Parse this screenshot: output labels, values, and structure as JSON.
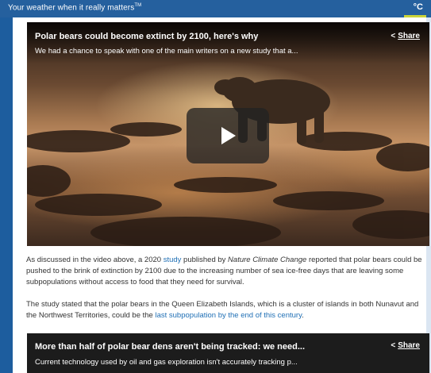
{
  "header": {
    "tagline": "Your weather when it really matters",
    "trademark": "TM",
    "unit": "°C"
  },
  "video": {
    "title": "Polar bears could become extinct by 2100, here's why",
    "description": "We had a chance to speak with one of the main writers on a new study that a...",
    "share_label": "Share"
  },
  "article": {
    "p1": {
      "t1": "As discussed in the video above, a 2020 ",
      "link": "study",
      "t2": " published by ",
      "journal": "Nature Climate Change",
      "t3": " reported that polar bears could be pushed to the brink of extinction by 2100 due to the increasing number of sea ice-free days that are leaving some subpopulations without access to food that they need for survival."
    },
    "p2": {
      "t1": "The study stated that the polar bears in the Queen Elizabeth Islands, which is a cluster of islands in both Nunavut and the Northwest Territories, could be the ",
      "link": "last subpopulation by the end of this century",
      "t2": "."
    }
  },
  "related": {
    "title": "More than half of polar bear dens aren't being tracked: we need...",
    "description": "Current technology used by oil and gas exploration isn't accurately tracking p...",
    "share_label": "Share"
  }
}
